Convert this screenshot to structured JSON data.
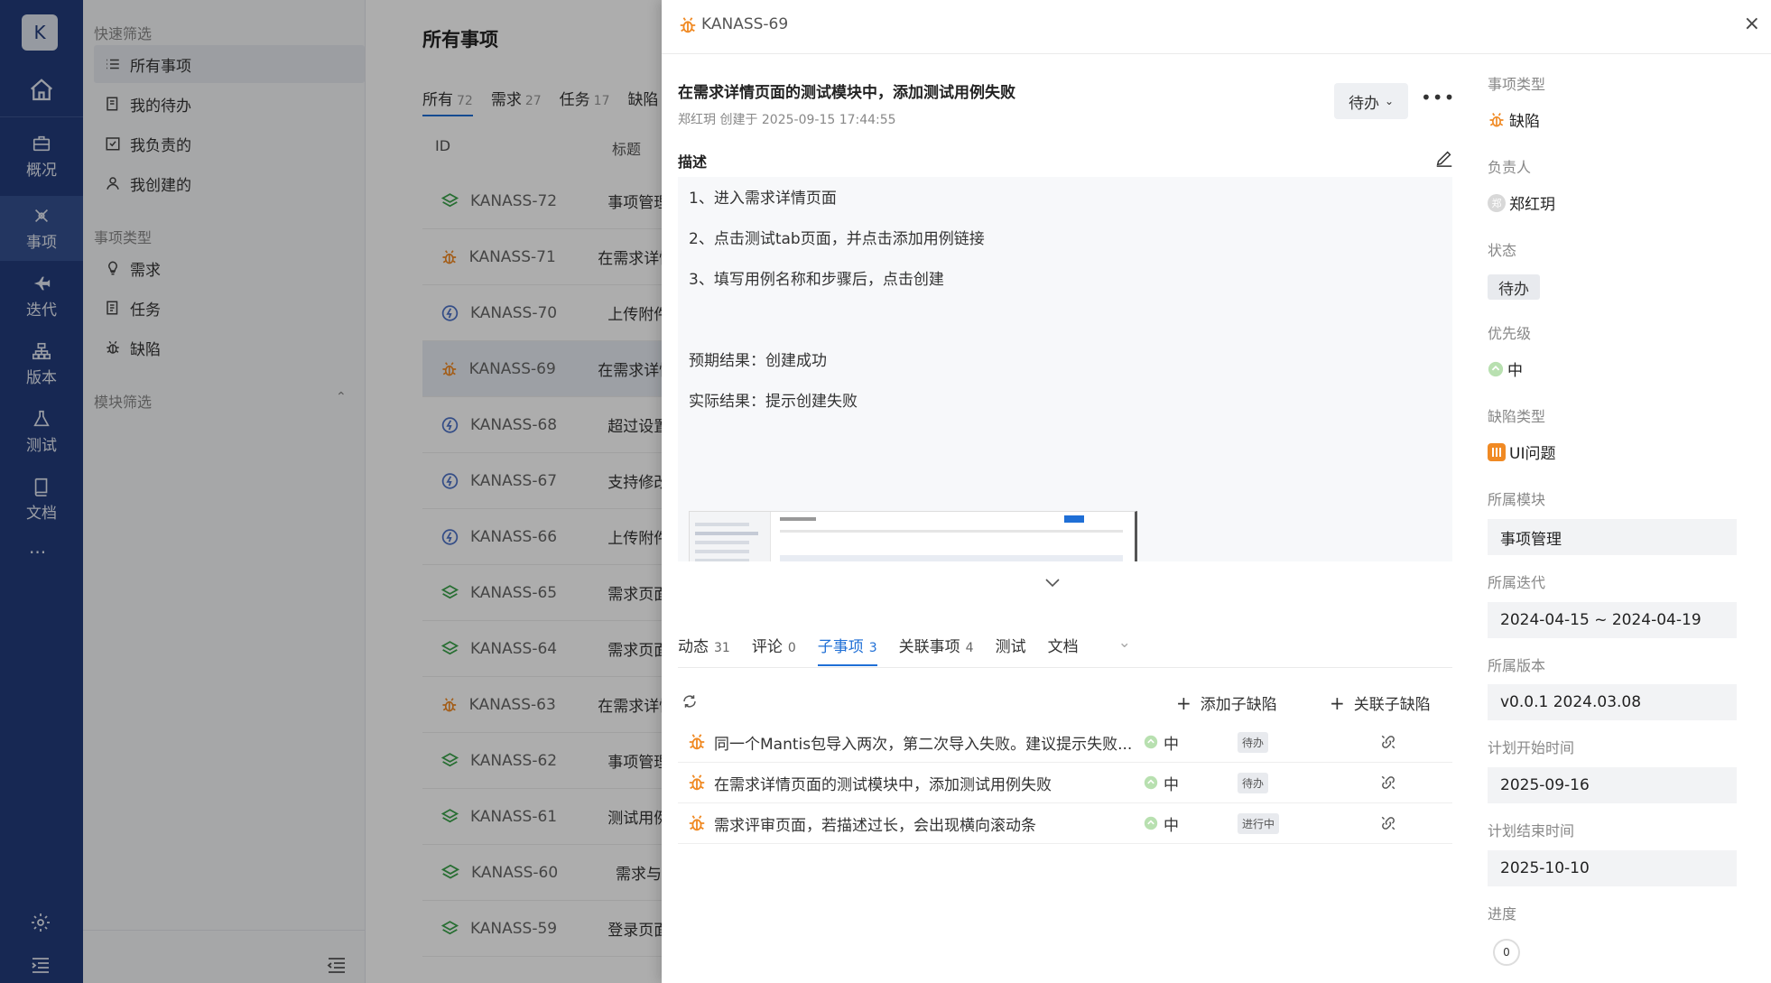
{
  "app": {
    "avatar_letter": "K",
    "rail": [
      {
        "label": "概况",
        "icon": "briefcase-icon"
      },
      {
        "label": "事项",
        "icon": "cross-icon"
      },
      {
        "label": "迭代",
        "icon": "fighter-jet-icon"
      },
      {
        "label": "版本",
        "icon": "sitemap-icon"
      },
      {
        "label": "测试",
        "icon": "flask-icon"
      },
      {
        "label": "文档",
        "icon": "book-icon"
      }
    ],
    "more": "···"
  },
  "sidebar": {
    "quick_filter_header": "快速筛选",
    "quick_filters": [
      "所有事项",
      "我的待办",
      "我负责的",
      "我创建的"
    ],
    "type_header": "事项类型",
    "types": [
      "需求",
      "任务",
      "缺陷"
    ],
    "module_header": "模块筛选"
  },
  "list": {
    "title": "所有事项",
    "tabs": [
      {
        "label": "所有",
        "count": "72"
      },
      {
        "label": "需求",
        "count": "27"
      },
      {
        "label": "任务",
        "count": "17"
      },
      {
        "label": "缺陷",
        "count": ""
      }
    ],
    "columns": {
      "id": "ID",
      "title": "标题"
    },
    "rows": [
      {
        "id": "KANASS-72",
        "title": "事项管理",
        "type": "story"
      },
      {
        "id": "KANASS-71",
        "title": "在需求详情",
        "type": "bug"
      },
      {
        "id": "KANASS-70",
        "title": "上传附件",
        "type": "task"
      },
      {
        "id": "KANASS-69",
        "title": "在需求详情",
        "type": "bug"
      },
      {
        "id": "KANASS-68",
        "title": "超过设置",
        "type": "task"
      },
      {
        "id": "KANASS-67",
        "title": "支持修改",
        "type": "task"
      },
      {
        "id": "KANASS-66",
        "title": "上传附件",
        "type": "task"
      },
      {
        "id": "KANASS-65",
        "title": "需求页面",
        "type": "story"
      },
      {
        "id": "KANASS-64",
        "title": "需求页面",
        "type": "story"
      },
      {
        "id": "KANASS-63",
        "title": "在需求详情",
        "type": "bug"
      },
      {
        "id": "KANASS-62",
        "title": "事项管理",
        "type": "story"
      },
      {
        "id": "KANASS-61",
        "title": "测试用例",
        "type": "story"
      },
      {
        "id": "KANASS-60",
        "title": "需求与",
        "type": "story"
      },
      {
        "id": "KANASS-59",
        "title": "登录页面",
        "type": "story"
      }
    ]
  },
  "drawer": {
    "key": "KANASS-69",
    "close": "×",
    "title": "在需求详情页面的测试模块中，添加测试用例失败",
    "meta": "郑红玥 创建于 2025-09-15 17:44:55",
    "status_button": "待办",
    "more": "•••",
    "desc_label": "描述",
    "description": [
      "1、进入需求详情页面",
      "2、点击测试tab页面，并点击添加用例链接",
      "3、填写用例名称和步骤后，点击创建",
      "",
      "预期结果：创建成功",
      "实际结果：提示创建失败"
    ],
    "tabs": [
      {
        "label": "动态",
        "count": "31"
      },
      {
        "label": "评论",
        "count": "0"
      },
      {
        "label": "子事项",
        "count": "3"
      },
      {
        "label": "关联事项",
        "count": "4"
      },
      {
        "label": "测试",
        "count": ""
      },
      {
        "label": "文档",
        "count": ""
      }
    ],
    "add_child": "添加子缺陷",
    "link_child": "关联子缺陷",
    "subitems": [
      {
        "title": "同一个Mantis包导入两次，第二次导入失败。建议提示失败...",
        "priority": "中",
        "status": "待办"
      },
      {
        "title": "在需求详情页面的测试模块中，添加测试用例失败",
        "priority": "中",
        "status": "待办"
      },
      {
        "title": "需求评审页面，若描述过长，会出现横向滚动条",
        "priority": "中",
        "status": "进行中"
      }
    ],
    "fields": {
      "type_label": "事项类型",
      "type_value": "缺陷",
      "owner_label": "负责人",
      "owner_value": "郑红玥",
      "owner_avatar": "郑",
      "status_label": "状态",
      "status_value": "待办",
      "priority_label": "优先级",
      "priority_value": "中",
      "bug_type_label": "缺陷类型",
      "bug_type_value": "UI问题",
      "module_label": "所属模块",
      "module_value": "事项管理",
      "sprint_label": "所属迭代",
      "sprint_value": "2024-04-15 ~ 2024-04-19",
      "version_label": "所属版本",
      "version_value": "v0.0.1 2024.03.08",
      "start_label": "计划开始时间",
      "start_value": "2025-09-16",
      "end_label": "计划结束时间",
      "end_value": "2025-10-10",
      "progress_label": "进度",
      "progress_value": "0"
    }
  },
  "colors": {
    "rail_bg": "#223c7b",
    "accent": "#1f6fd6",
    "bug": "#f08a24",
    "story": "#3aa24a",
    "task": "#4f74c8"
  }
}
